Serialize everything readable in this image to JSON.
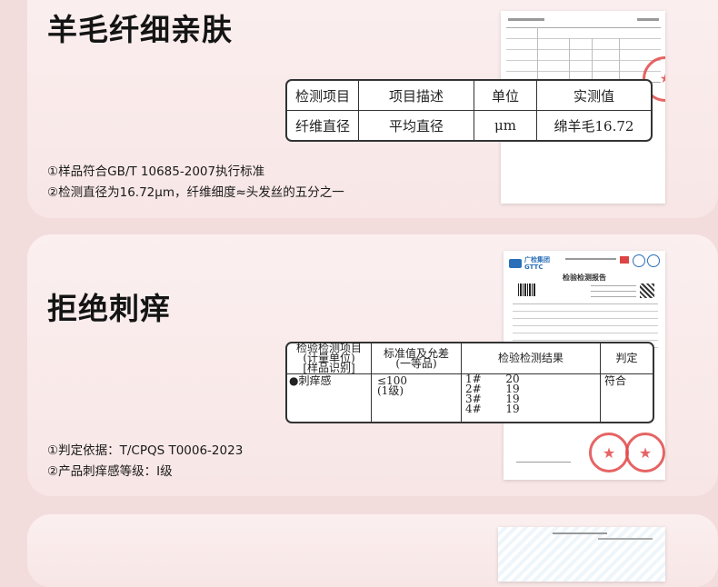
{
  "section1": {
    "title": "羊毛纤细亲肤",
    "table": {
      "headers": [
        "检测项目",
        "项目描述",
        "单位",
        "实测值"
      ],
      "row": [
        "纤维直径",
        "平均直径",
        "μm",
        "绵羊毛16.72"
      ]
    },
    "notes": [
      "①样品符合GB/T 10685-2007执行标准",
      "②检测直径为16.72μm，纤维细度≈头发丝的五分之一"
    ]
  },
  "section2": {
    "title": "拒绝刺痒",
    "report": {
      "org": "广检集团",
      "org_en": "GTTC",
      "doc_title": "检验检测报告"
    },
    "table": {
      "headers": [
        "检验检测项目\n(计量单位)\n[样品识别]",
        "标准值及允差\n(一等品)",
        "检验检测结果",
        "判定"
      ],
      "item": "●刺痒感",
      "standard": "≤100\n(1级)",
      "results": [
        {
          "no": "1#",
          "value": "20"
        },
        {
          "no": "2#",
          "value": "19"
        },
        {
          "no": "3#",
          "value": "19"
        },
        {
          "no": "4#",
          "value": "19"
        }
      ],
      "verdict": "符合"
    },
    "notes": [
      "①判定依据：T/CPQS T0006-2023",
      "②产品刺痒感等级：Ⅰ级"
    ]
  },
  "colors": {
    "background": "#f3dcdc",
    "card": "#fbefef",
    "stamp": "#e24a4a"
  }
}
